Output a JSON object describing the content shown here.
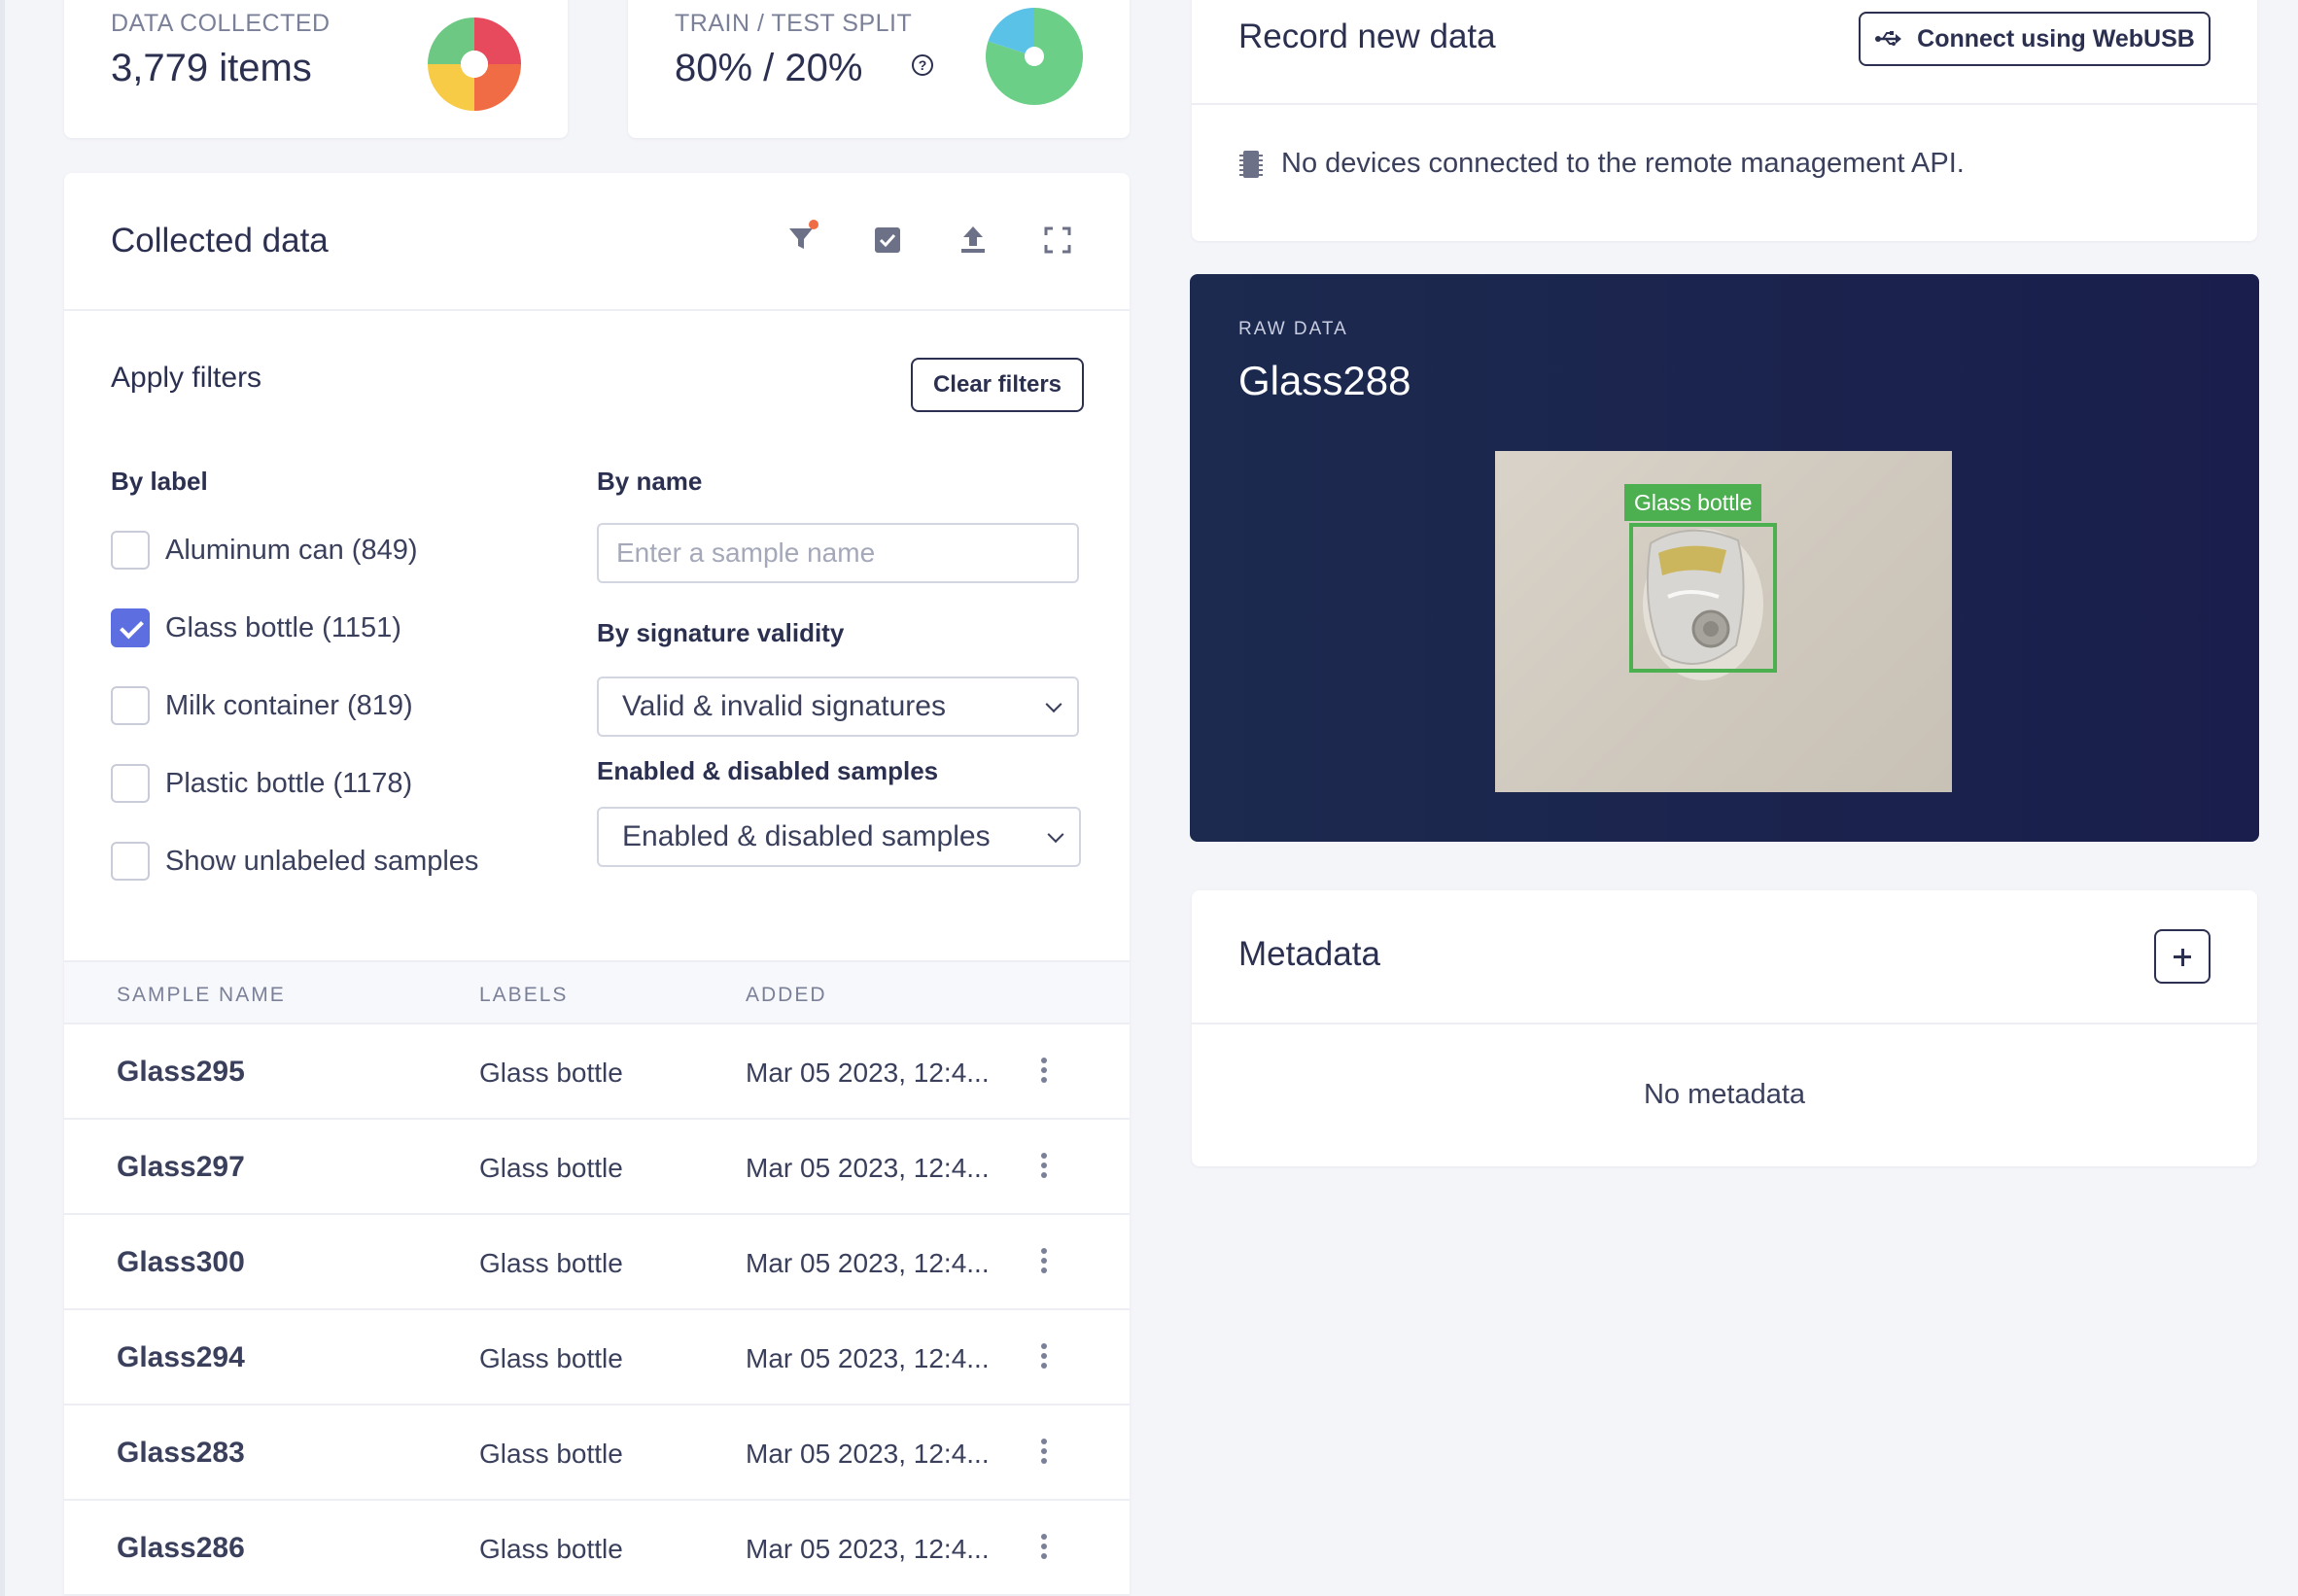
{
  "stats": {
    "data_collected": {
      "label": "DATA COLLECTED",
      "value": "3,779 items"
    },
    "train_test_split": {
      "label": "TRAIN / TEST SPLIT",
      "value": "80% / 20%",
      "help_glyph": "?"
    }
  },
  "collected": {
    "title": "Collected data",
    "toolbar_icons": [
      "filter-icon",
      "select-checkbox-icon",
      "upload-icon",
      "fullscreen-icon"
    ],
    "filters": {
      "title": "Apply filters",
      "clear_label": "Clear filters",
      "by_label": {
        "heading": "By label",
        "options": [
          {
            "label": "Aluminum can (849)",
            "checked": false
          },
          {
            "label": "Glass bottle (1151)",
            "checked": true
          },
          {
            "label": "Milk container (819)",
            "checked": false
          },
          {
            "label": "Plastic bottle (1178)",
            "checked": false
          },
          {
            "label": "Show unlabeled samples",
            "checked": false
          }
        ]
      },
      "by_name": {
        "heading": "By name",
        "placeholder": "Enter a sample name",
        "value": ""
      },
      "by_signature": {
        "heading": "By signature validity",
        "selected": "Valid & invalid signatures"
      },
      "enabled": {
        "heading": "Enabled & disabled samples",
        "selected": "Enabled & disabled samples"
      }
    },
    "table": {
      "columns": [
        "SAMPLE NAME",
        "LABELS",
        "ADDED"
      ],
      "rows": [
        {
          "name": "Glass295",
          "label": "Glass bottle",
          "added": "Mar 05 2023, 12:4..."
        },
        {
          "name": "Glass297",
          "label": "Glass bottle",
          "added": "Mar 05 2023, 12:4..."
        },
        {
          "name": "Glass300",
          "label": "Glass bottle",
          "added": "Mar 05 2023, 12:4..."
        },
        {
          "name": "Glass294",
          "label": "Glass bottle",
          "added": "Mar 05 2023, 12:4..."
        },
        {
          "name": "Glass283",
          "label": "Glass bottle",
          "added": "Mar 05 2023, 12:4..."
        },
        {
          "name": "Glass286",
          "label": "Glass bottle",
          "added": "Mar 05 2023, 12:4..."
        }
      ]
    }
  },
  "record": {
    "title": "Record new data",
    "connect_label": "Connect using WebUSB",
    "no_devices_text": "No devices connected to the remote management API."
  },
  "raw_data": {
    "label": "RAW DATA",
    "title": "Glass288",
    "bbox_label": "Glass bottle"
  },
  "metadata": {
    "title": "Metadata",
    "empty_text": "No metadata"
  },
  "colors": {
    "accent": "#5c6ee0",
    "dark_panel": "#1c2a4f",
    "bbox_green": "#4caf50",
    "text_dark": "#2c3050"
  }
}
